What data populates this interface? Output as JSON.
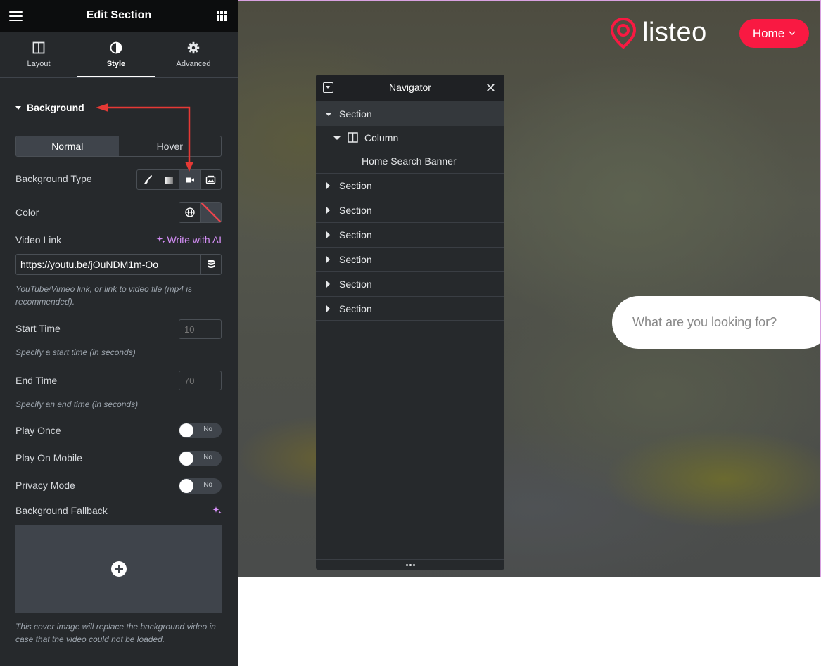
{
  "panel": {
    "title": "Edit Section",
    "tabs": [
      {
        "label": "Layout",
        "icon": "layout-icon"
      },
      {
        "label": "Style",
        "icon": "contrast-icon",
        "active": true
      },
      {
        "label": "Advanced",
        "icon": "gear-icon"
      }
    ],
    "section_title": "Background",
    "state_tabs": {
      "normal": "Normal",
      "hover": "Hover",
      "active": "Normal"
    },
    "background_type": {
      "label": "Background Type",
      "options": [
        "classic-brush-icon",
        "gradient-icon",
        "video-icon",
        "slideshow-icon"
      ],
      "selected": "video-icon"
    },
    "color": {
      "label": "Color"
    },
    "video_link": {
      "label": "Video Link",
      "ai_label": "Write with AI",
      "value": "https://youtu.be/jOuNDM1m-Oo",
      "help": "YouTube/Vimeo link, or link to video file (mp4 is recommended)."
    },
    "start_time": {
      "label": "Start Time",
      "placeholder": "10",
      "help": "Specify a start time (in seconds)"
    },
    "end_time": {
      "label": "End Time",
      "placeholder": "70",
      "help": "Specify an end time (in seconds)"
    },
    "play_once": {
      "label": "Play Once",
      "state": "No"
    },
    "play_on_mobile": {
      "label": "Play On Mobile",
      "state": "No"
    },
    "privacy_mode": {
      "label": "Privacy Mode",
      "state": "No"
    },
    "fallback": {
      "label": "Background Fallback",
      "help": "This cover image will replace the background video in case that the video could not be loaded."
    }
  },
  "preview": {
    "logo_text": "listeo",
    "home_button": "Home",
    "search_placeholder": "What are you looking for?",
    "brand_color": "#f91942"
  },
  "navigator": {
    "title": "Navigator",
    "tree": [
      {
        "label": "Section",
        "expanded": true
      },
      {
        "label": "Column",
        "expanded": true
      },
      {
        "label": "Home Search Banner"
      },
      {
        "label": "Section"
      },
      {
        "label": "Section"
      },
      {
        "label": "Section"
      },
      {
        "label": "Section"
      },
      {
        "label": "Section"
      },
      {
        "label": "Section"
      }
    ]
  },
  "colors": {
    "panel_bg": "#26292c",
    "topbar_bg": "#0c0d0e",
    "accent_ai": "#d58ff7",
    "annotation_arrow": "#e53935"
  }
}
